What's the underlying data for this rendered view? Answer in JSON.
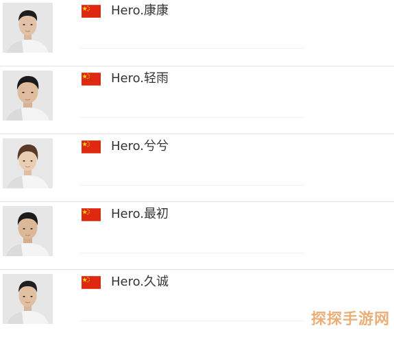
{
  "roster": {
    "players": [
      {
        "name": "Hero.康康",
        "flag": "china-flag-icon"
      },
      {
        "name": "Hero.轻雨",
        "flag": "china-flag-icon"
      },
      {
        "name": "Hero.兮兮",
        "flag": "china-flag-icon"
      },
      {
        "name": "Hero.最初",
        "flag": "china-flag-icon"
      },
      {
        "name": "Hero.久诚",
        "flag": "china-flag-icon"
      }
    ]
  },
  "colors": {
    "flag_red": "#de2910",
    "flag_star": "#ffde00",
    "avatar_bg": "#e8e8e8",
    "text": "#333333",
    "divider": "#e3e3e3"
  },
  "watermark": "探探手游网"
}
